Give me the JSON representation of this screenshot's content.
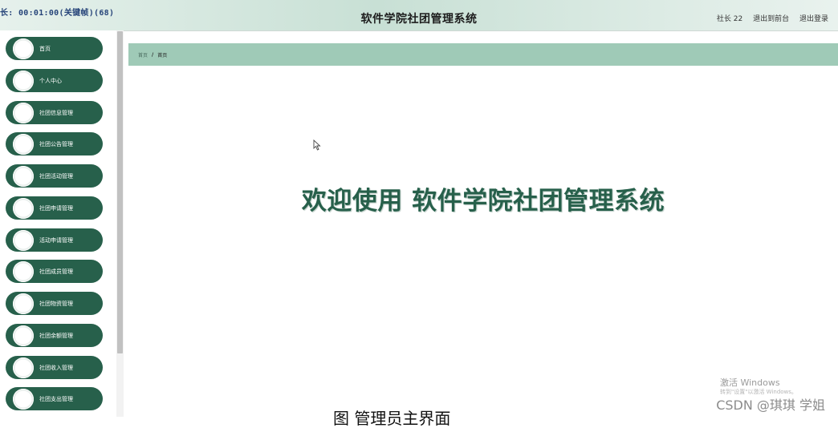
{
  "header": {
    "overlay_label": "长: 00:01:00(关键帧)(68)",
    "title": "软件学院社团管理系统",
    "user_role": "社长 22",
    "back_to_front": "退出到前台",
    "logout": "退出登录"
  },
  "sidebar": {
    "items": [
      {
        "label": "首页",
        "icon": "gear-icon"
      },
      {
        "label": "个人中心",
        "icon": "gear-icon"
      },
      {
        "label": "社团信息管理",
        "icon": "gear-icon"
      },
      {
        "label": "社团公告管理",
        "icon": "gear-icon"
      },
      {
        "label": "社团活动管理",
        "icon": "gear-icon"
      },
      {
        "label": "社团申请管理",
        "icon": "gear-icon"
      },
      {
        "label": "活动申请管理",
        "icon": "gear-icon"
      },
      {
        "label": "社团成员管理",
        "icon": "gear-icon"
      },
      {
        "label": "社团物资管理",
        "icon": "gear-icon"
      },
      {
        "label": "社团余额管理",
        "icon": "gear-icon"
      },
      {
        "label": "社团收入管理",
        "icon": "gear-icon"
      },
      {
        "label": "社团支出管理",
        "icon": "gear-icon"
      }
    ]
  },
  "breadcrumb": {
    "home": "首页",
    "separator": "/",
    "current": "首页"
  },
  "main": {
    "welcome": "欢迎使用 软件学院社团管理系统"
  },
  "overlays": {
    "activate_title": "激活 Windows",
    "activate_sub": "转到\"设置\"以激活 Windows。",
    "watermark": "CSDN @琪琪 学姐",
    "caption": "图   管理员主界面"
  },
  "colors": {
    "accent": "#27604b",
    "breadcrumb_bg": "#9fcab7",
    "header_bg": "#c8e0d5"
  }
}
